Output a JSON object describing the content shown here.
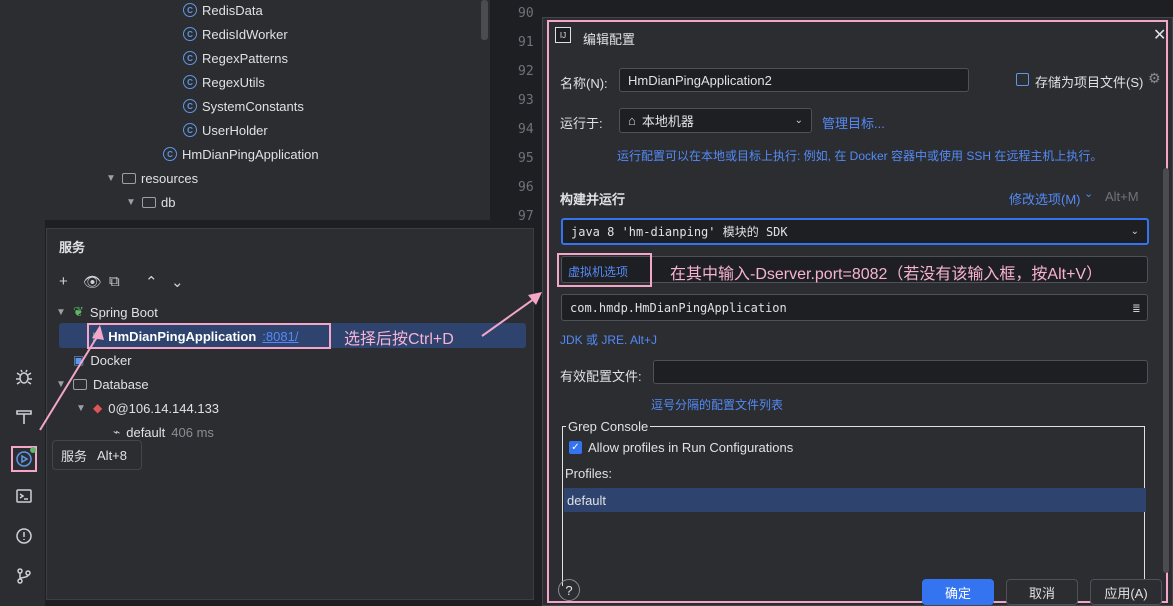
{
  "project_tree": {
    "items": [
      {
        "label": "RedisData",
        "kind": "class"
      },
      {
        "label": "RedisIdWorker",
        "kind": "class"
      },
      {
        "label": "RegexPatterns",
        "kind": "class"
      },
      {
        "label": "RegexUtils",
        "kind": "class"
      },
      {
        "label": "SystemConstants",
        "kind": "class"
      },
      {
        "label": "UserHolder",
        "kind": "class"
      },
      {
        "label": "HmDianPingApplication",
        "kind": "app-class"
      },
      {
        "label": "resources",
        "kind": "folder"
      },
      {
        "label": "db",
        "kind": "folder"
      }
    ]
  },
  "editor": {
    "line_numbers": [
      "90",
      "91",
      "92",
      "93",
      "94",
      "95",
      "96",
      "97"
    ]
  },
  "services": {
    "title": "服务",
    "tree": {
      "spring_boot": "Spring Boot",
      "app_name": "HmDianPingApplication",
      "app_port": ":8081/",
      "docker": "Docker",
      "database": "Database",
      "db_conn": "0@106.14.144.133",
      "schema": "default",
      "schema_latency": "406 ms"
    }
  },
  "tooltip": {
    "label": "服务",
    "shortcut": "Alt+8"
  },
  "dialog": {
    "title": "编辑配置",
    "name_label": "名称(N):",
    "name_value": "HmDianPingApplication2",
    "store_as_project_file": "存储为项目文件(S)",
    "run_on_label": "运行于:",
    "run_on_value": "本地机器",
    "manage_targets": "管理目标...",
    "run_on_hint": "运行配置可以在本地或目标上执行: 例如, 在 Docker 容器中或使用 SSH 在远程主机上执行。",
    "build_run_label": "构建并运行",
    "modify_options": "修改选项(M)",
    "modify_shortcut": "Alt+M",
    "sdk_value": "java 8 'hm-dianping' 模块的 SDK",
    "vm_options_placeholder": "虚拟机选项",
    "main_class": "com.hmdp.HmDianPingApplication",
    "jdk_hint": "JDK 或 JRE. Alt+J",
    "active_profiles_label": "有效配置文件:",
    "active_profiles_value": "",
    "profiles_hint": "逗号分隔的配置文件列表",
    "grep_console_title": "Grep Console",
    "allow_profiles_label": "Allow profiles in Run Configurations",
    "allow_profiles_checked": true,
    "profiles_label": "Profiles:",
    "profiles_items": [
      "default"
    ],
    "ok": "确定",
    "cancel": "取消",
    "apply": "应用(A)",
    "help": "?"
  },
  "annotations": {
    "select_hint": "选择后按Ctrl+D",
    "vm_hint": "在其中输入-Dserver.port=8082（若没有该输入框，按Alt+V）"
  },
  "colors": {
    "background": "#1e1f22",
    "panel": "#2b2d30",
    "accent": "#3574f0",
    "link": "#548af7",
    "annotation": "#f3a6c8",
    "run_green": "#5fb865"
  }
}
